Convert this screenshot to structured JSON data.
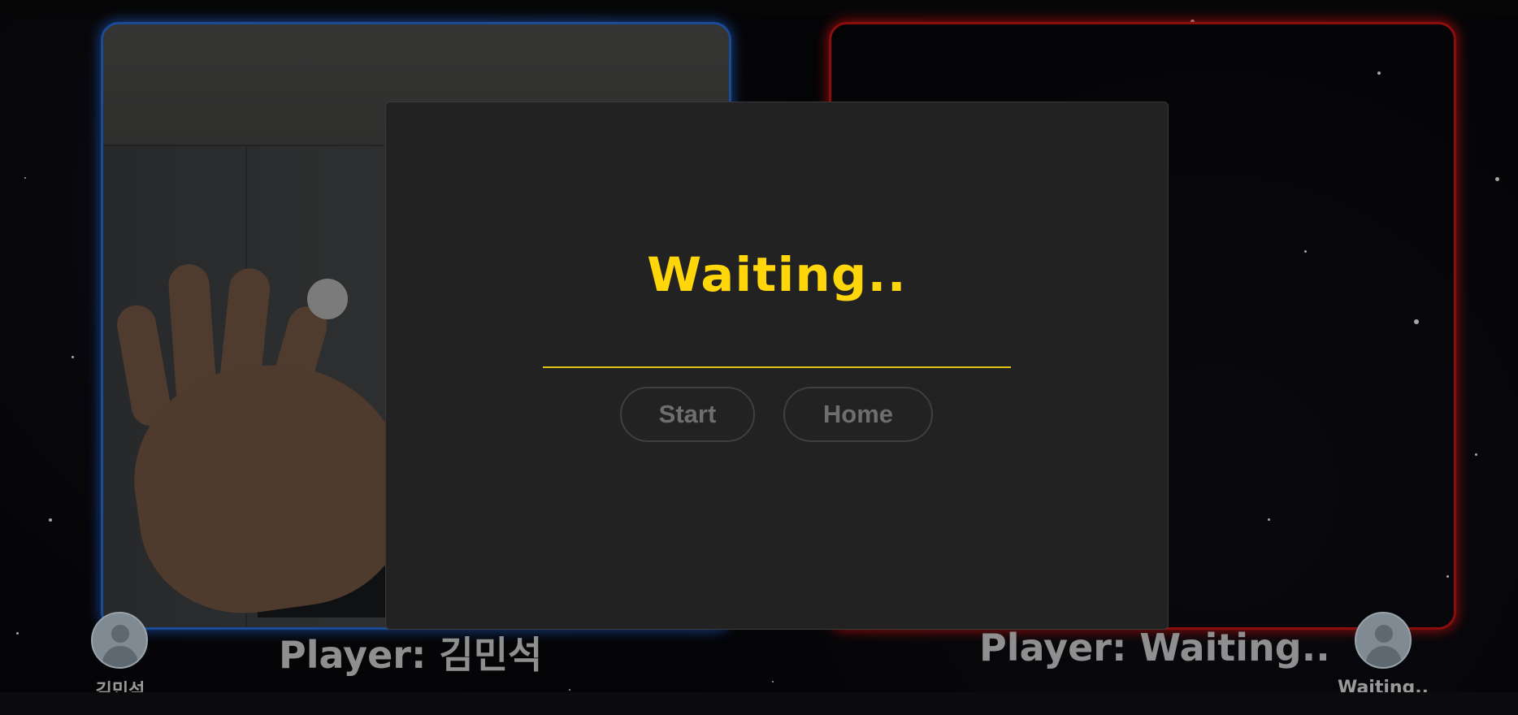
{
  "modal": {
    "title": "Waiting..",
    "start_label": "Start",
    "home_label": "Home"
  },
  "players": {
    "left": {
      "label": "Player: 김민석",
      "avatar_name": "김민석",
      "frame_color": "#2a73e6"
    },
    "right": {
      "label": "Player: Waiting..",
      "avatar_name": "Waiting..",
      "frame_color": "#d61414"
    }
  },
  "colors": {
    "accent": "#ffd60a",
    "background": "#050507",
    "modal": "#222222"
  },
  "icons": {
    "avatar": "user-avatar-icon",
    "cursor": "hand-tracking-cursor"
  }
}
